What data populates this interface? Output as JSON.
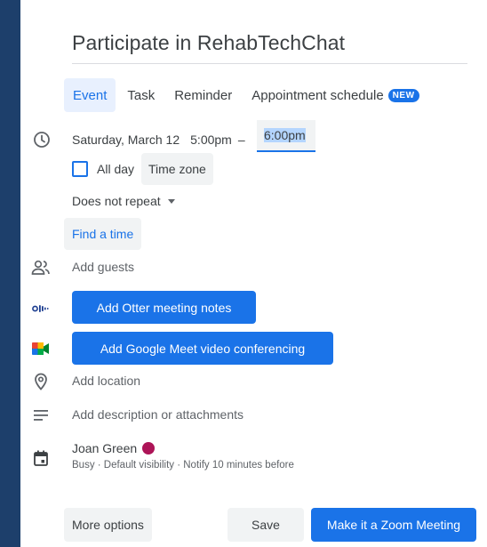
{
  "event": {
    "title": "Participate in RehabTechChat"
  },
  "tabs": [
    {
      "label": "Event",
      "active": true
    },
    {
      "label": "Task",
      "active": false
    },
    {
      "label": "Reminder",
      "active": false
    },
    {
      "label": "Appointment schedule",
      "active": false,
      "badge": "NEW"
    }
  ],
  "datetime": {
    "date": "Saturday, March 12",
    "start": "5:00pm",
    "dash": "–",
    "end": "6:00pm"
  },
  "all_day": {
    "label": "All day",
    "checked": false
  },
  "time_zone_label": "Time zone",
  "repeat_label": "Does not repeat",
  "find_time_label": "Find a time",
  "guests_placeholder": "Add guests",
  "otter_button": "Add Otter meeting notes",
  "meet_button": "Add Google Meet video conferencing",
  "location_placeholder": "Add location",
  "description_placeholder": "Add description or attachments",
  "calendar": {
    "owner": "Joan Green",
    "color": "#ad1457",
    "details": "Busy · Default visibility · Notify 10 minutes before"
  },
  "footer": {
    "more_options": "More options",
    "save": "Save",
    "zoom": "Make it a Zoom Meeting"
  },
  "colors": {
    "accent": "#1a73e8",
    "background": "#1d3f6b"
  },
  "icons": {
    "time": "clock-icon",
    "guests": "people-icon",
    "otter": "otter-icon",
    "meet": "google-meet-icon",
    "location": "location-pin-icon",
    "description": "notes-icon",
    "calendar": "calendar-icon",
    "dropdown": "caret-down-icon"
  }
}
